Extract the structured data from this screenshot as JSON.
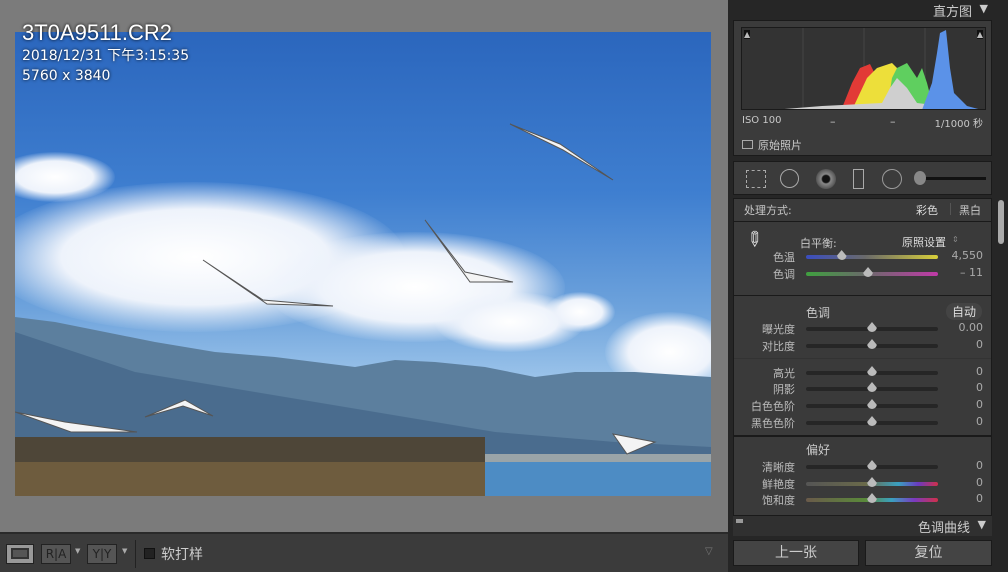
{
  "photo": {
    "filename": "3T0A9511.CR2",
    "datetime": "2018/12/31 下午3:15:35",
    "dimensions": "5760 x 3840"
  },
  "toolbar": {
    "view_button": "loupe-view",
    "before_after_ra": "R|A",
    "before_after_yy": "Y|Y",
    "soft_proof_label": "软打样"
  },
  "histogram": {
    "title": "直方图",
    "iso": "ISO 100",
    "dash1": "–",
    "dash2": "–",
    "shutter": "1/1000 秒",
    "original_photo_label": "原始照片"
  },
  "basic": {
    "treatment_label": "处理方式:",
    "color": "彩色",
    "bw": "黑白",
    "wb_label": "白平衡:",
    "wb_value": "原照设置",
    "temp": {
      "label": "色温",
      "value": "4,550",
      "position": 0.27
    },
    "tint": {
      "label": "色调",
      "value": "– 11",
      "position": 0.47
    },
    "tone_title": "色调",
    "auto": "自动",
    "exposure": {
      "label": "曝光度",
      "value": "0.00",
      "position": 0.5
    },
    "contrast": {
      "label": "对比度",
      "value": "0",
      "position": 0.5
    },
    "highlights": {
      "label": "高光",
      "value": "0",
      "position": 0.5
    },
    "shadows": {
      "label": "阴影",
      "value": "0",
      "position": 0.5
    },
    "whites": {
      "label": "白色色阶",
      "value": "0",
      "position": 0.5
    },
    "blacks": {
      "label": "黑色色阶",
      "value": "0",
      "position": 0.5
    },
    "presence_title": "偏好",
    "clarity": {
      "label": "清晰度",
      "value": "0",
      "position": 0.5
    },
    "vibrance": {
      "label": "鲜艳度",
      "value": "0",
      "position": 0.5
    },
    "saturation": {
      "label": "饱和度",
      "value": "0",
      "position": 0.5
    }
  },
  "tone_curve_title": "色调曲线",
  "buttons": {
    "previous": "上一张",
    "reset": "复位"
  }
}
